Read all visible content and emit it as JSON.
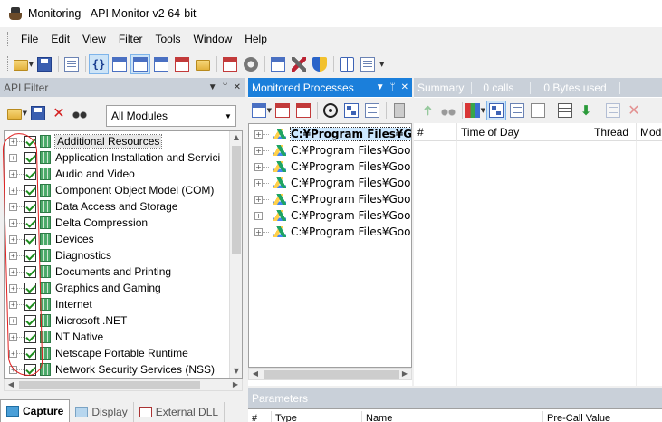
{
  "window": {
    "title": "Monitoring - API Monitor v2 64-bit"
  },
  "menu": [
    "File",
    "Edit",
    "View",
    "Filter",
    "Tools",
    "Window",
    "Help"
  ],
  "api_filter": {
    "title": "API Filter",
    "module_select": "All Modules",
    "items": [
      "Additional Resources",
      "Application Installation and Servici",
      "Audio and Video",
      "Component Object Model (COM)",
      "Data Access and Storage",
      "Delta Compression",
      "Devices",
      "Diagnostics",
      "Documents and Printing",
      "Graphics and Gaming",
      "Internet",
      "Microsoft .NET",
      "NT Native",
      "Netscape Portable Runtime",
      "Network Security Services (NSS)"
    ],
    "tabs": [
      "Capture",
      "Display",
      "External DLL"
    ]
  },
  "monitored_processes": {
    "title": "Monitored Processes",
    "processes": [
      "C:¥Program Files¥Goog",
      "C:¥Program Files¥Googl",
      "C:¥Program Files¥Googl",
      "C:¥Program Files¥Googl",
      "C:¥Program Files¥Googl",
      "C:¥Program Files¥Googl",
      "C:¥Program Files¥Googl"
    ]
  },
  "summary": {
    "title": "Summary",
    "calls": "0 calls",
    "bytes": "0 Bytes used",
    "columns": [
      "#",
      "Time of Day",
      "Thread",
      "Modu"
    ]
  },
  "parameters": {
    "title": "Parameters",
    "columns": [
      "#",
      "Type",
      "Name",
      "Pre-Call Value"
    ]
  },
  "colors": {
    "active_header": "#1b7fdb",
    "inactive_header": "#c9d0d9",
    "annotation": "#e02020"
  }
}
